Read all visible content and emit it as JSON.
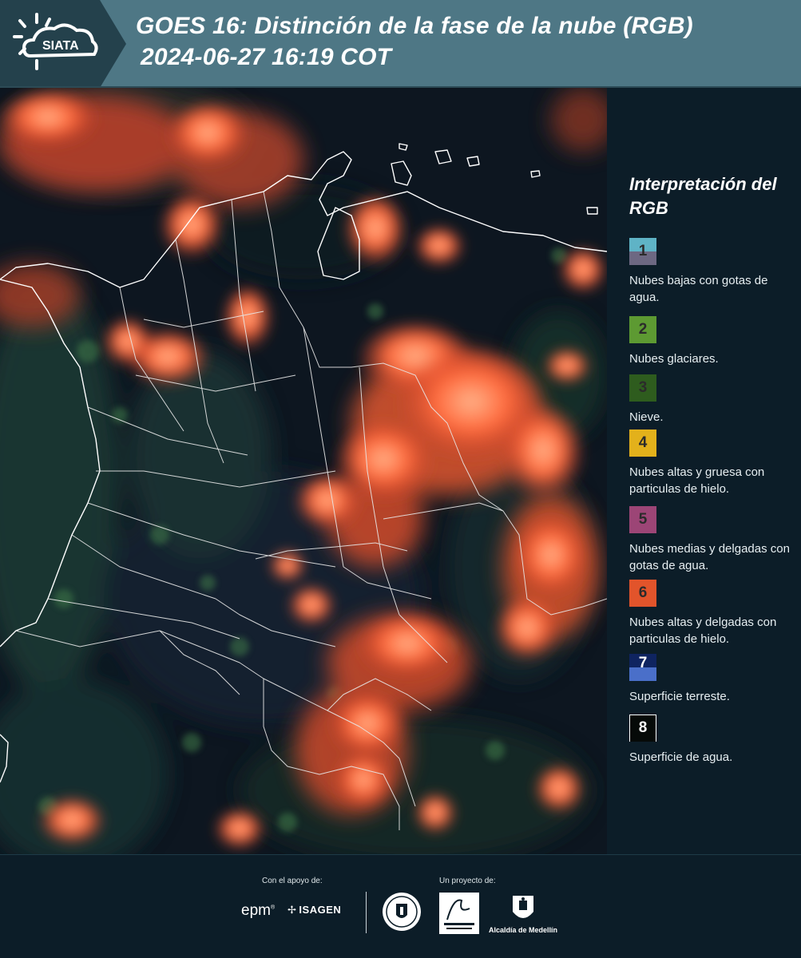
{
  "header": {
    "title_line1": "GOES 16: Distinción de la fase de la nube (RGB)",
    "title_line2": "2024-06-27 16:19 COT",
    "logo_text": "SIATA"
  },
  "legend": {
    "title": "Interpretación del RGB",
    "items": [
      {
        "num": "1",
        "label": "Nubes bajas con gotas de agua.",
        "color_top": "#5fb3c6",
        "color_bottom": "#6d6882"
      },
      {
        "num": "2",
        "label": "Nubes glaciares.",
        "color_top": "#5d9a32",
        "color_bottom": "#5d9a32"
      },
      {
        "num": "3",
        "label": "Nieve.",
        "color_top": "#2e5c1e",
        "color_bottom": "#2e5c1e"
      },
      {
        "num": "4",
        "label": "Nubes altas y gruesa con particulas de hielo.",
        "color_top": "#e3b11b",
        "color_bottom": "#e3b11b"
      },
      {
        "num": "5",
        "label": "Nubes medias y delgadas con gotas de agua.",
        "color_top": "#9c4576",
        "color_bottom": "#9c4576"
      },
      {
        "num": "6",
        "label": "Nubes altas y delgadas con particulas de hielo.",
        "color_top": "#e2542b",
        "color_bottom": "#e2542b"
      },
      {
        "num": "7",
        "label": "Superficie terreste.",
        "color_top": "#0f2460",
        "color_bottom": "#4a6fc9"
      },
      {
        "num": "8",
        "label": "Superficie de agua.",
        "color_top": "#060a08",
        "color_bottom": "#060a08"
      }
    ]
  },
  "footer": {
    "support_label": "Con el apoyo de:",
    "project_label": "Un proyecto de:",
    "epm": "epm",
    "isagen": "ISAGEN",
    "medellin": "Alcaldía de Medellín"
  },
  "colors": {
    "header_bg": "#4e7785",
    "page_bg": "#0c1d28",
    "cloud_orange": "#ff6a3d",
    "map_dark": "#0d1620"
  }
}
